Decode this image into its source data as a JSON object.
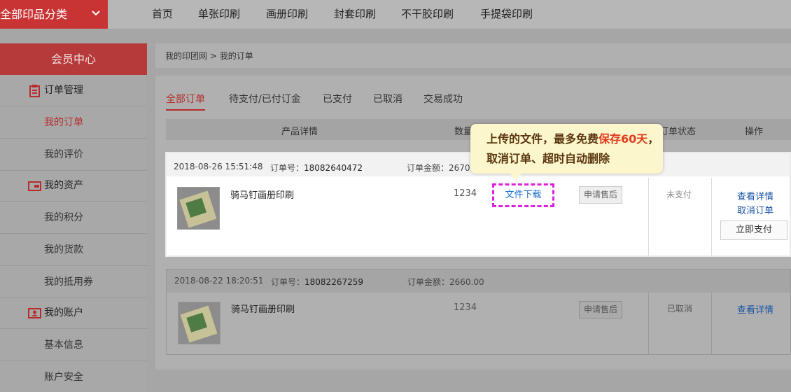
{
  "topnav": {
    "category_button": "全部印品分类",
    "items": [
      "首页",
      "单张印刷",
      "画册印刷",
      "封套印刷",
      "不干胶印刷",
      "手提袋印刷"
    ]
  },
  "sidebar": {
    "member_center": "会员中心",
    "sections": [
      {
        "title": "订单管理",
        "icon": "clipboard-icon",
        "items": [
          "我的订单",
          "我的评价"
        ]
      },
      {
        "title": "我的资产",
        "icon": "wallet-icon",
        "items": [
          "我的积分",
          "我的货款",
          "我的抵用券"
        ]
      },
      {
        "title": "我的账户",
        "icon": "user-card-icon",
        "items": [
          "基本信息",
          "账户安全"
        ]
      }
    ],
    "active_item": "我的订单"
  },
  "breadcrumb": {
    "home": "我的印团网",
    "separator": ">",
    "current": "我的订单"
  },
  "tabs": [
    "全部订单",
    "待支付/已付订金",
    "已支付",
    "已取消",
    "交易成功"
  ],
  "table_header": {
    "product": "产品详情",
    "qty": "数量",
    "status": "订单状态",
    "ops": "操作"
  },
  "orders": [
    {
      "datetime": "2018-08-26 15:51:48",
      "order_no_label": "订单号：",
      "order_no": "18082640472",
      "amount_label": "订单金额：",
      "amount": "2670.",
      "product": "骑马钉画册印刷",
      "qty": "1234",
      "download": "文件下载",
      "after_sale": "申请售后",
      "status": "未支付",
      "view_detail": "查看详情",
      "cancel_order": "取消订单",
      "pay_now": "立即支付"
    },
    {
      "datetime": "2018-08-22 18:20:51",
      "order_no_label": "订单号：",
      "order_no": "18082267259",
      "amount_label": "订单金额：",
      "amount": "2660.00",
      "product": "骑马钉画册印刷",
      "qty": "1234",
      "after_sale": "申请售后",
      "status": "已取消",
      "view_detail": "查看详情"
    }
  ],
  "tooltip": {
    "line1_a": "上传的文件，最多免费",
    "line1_highlight": "保存60天",
    "line1_b": "，",
    "line2": "取消订单、超时自动删除"
  },
  "colors": {
    "brand_red": "#c83434",
    "link_blue": "#1a55a6",
    "highlight_magenta": "#e01ee0",
    "tooltip_bg": "#fbf6cc",
    "tooltip_highlight": "#e23b1c"
  }
}
